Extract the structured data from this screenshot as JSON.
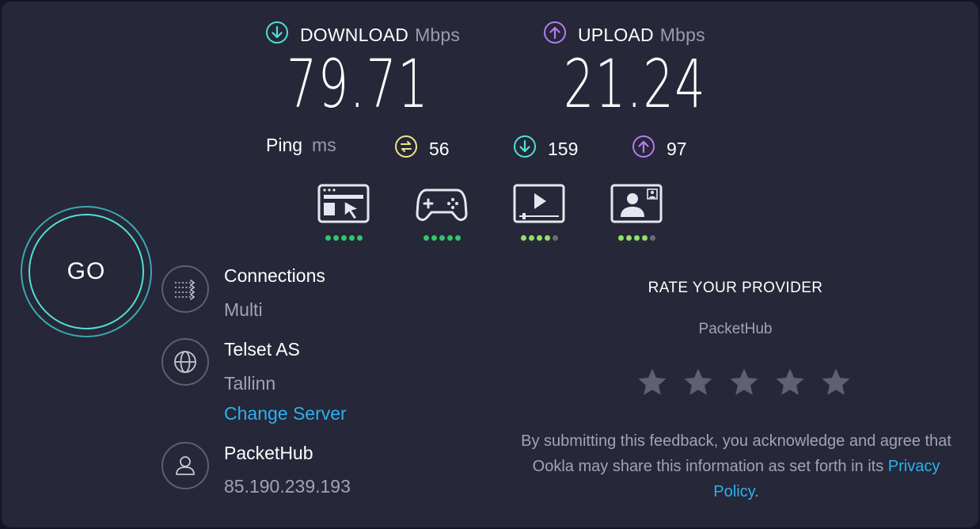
{
  "download": {
    "label": "DOWNLOAD",
    "unit": "Mbps",
    "value": "79.71"
  },
  "upload": {
    "label": "UPLOAD",
    "unit": "Mbps",
    "value": "21.24"
  },
  "ping": {
    "label": "Ping",
    "unit": "ms",
    "idle": "56",
    "download": "159",
    "upload": "97"
  },
  "quality": [
    {
      "name": "web-browsing",
      "score": 5,
      "of": 5
    },
    {
      "name": "gaming",
      "score": 5,
      "of": 5
    },
    {
      "name": "video-streaming",
      "score": 4,
      "of": 5
    },
    {
      "name": "video-chat",
      "score": 4,
      "of": 5
    }
  ],
  "go_label": "GO",
  "connections": {
    "title": "Connections",
    "value": "Multi"
  },
  "server": {
    "name": "Telset AS",
    "location": "Tallinn",
    "change_label": "Change Server"
  },
  "provider": {
    "name": "PacketHub",
    "ip": "85.190.239.193"
  },
  "rate": {
    "title": "RATE YOUR PROVIDER",
    "provider": "PacketHub",
    "stars": 5,
    "feedback_text": "By submitting this feedback, you acknowledge and agree that Ookla may share this information as set forth in its ",
    "policy_link": "Privacy Policy",
    "feedback_end": "."
  },
  "colors": {
    "download": "#4fe0d8",
    "upload": "#b57bf2",
    "ping": "#f1e38a",
    "link": "#2ab2f1",
    "dot_on": "#2fc76a",
    "dot_lite": "#8fe163",
    "dot_off": "#6a6b7a",
    "star": "#5f6072"
  }
}
